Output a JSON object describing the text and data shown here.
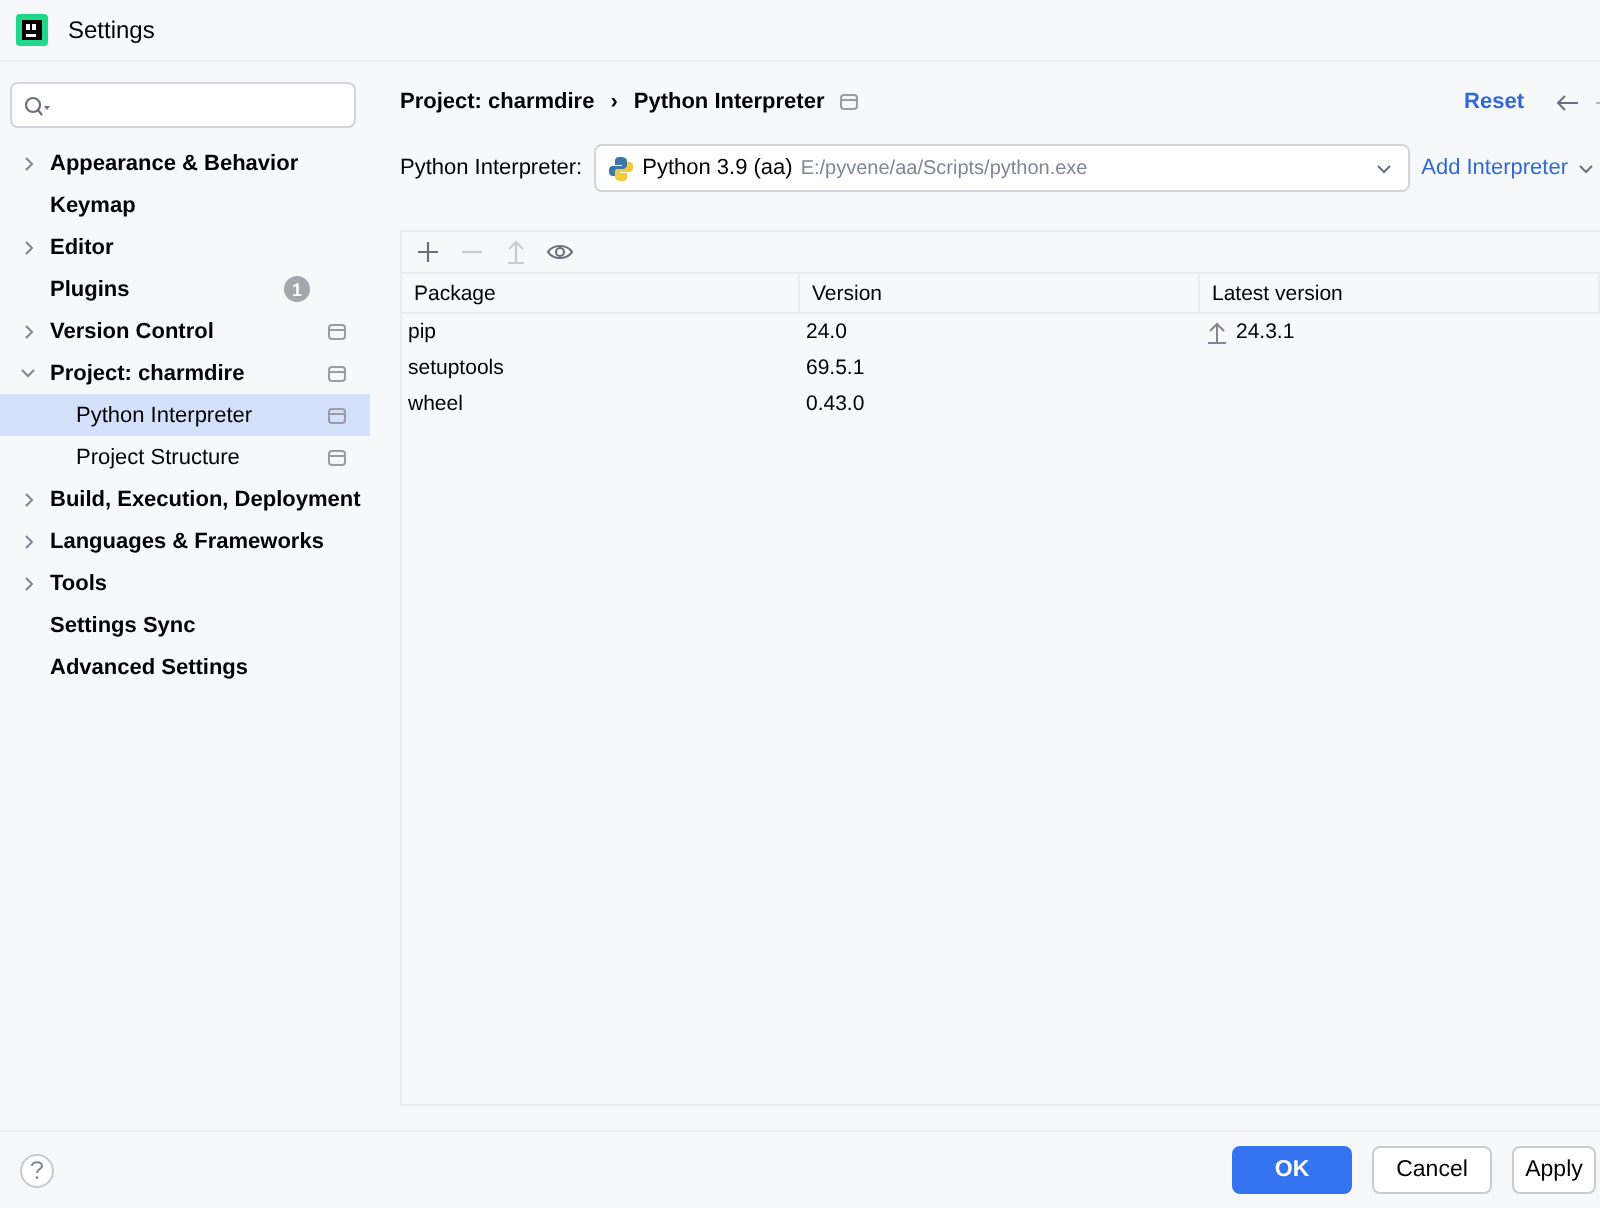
{
  "window": {
    "title": "Settings"
  },
  "sidebar": {
    "items": [
      {
        "label": "Appearance & Behavior",
        "expanded": false,
        "selected": false,
        "project_scope": false
      },
      {
        "label": "Keymap",
        "selected": false,
        "project_scope": false
      },
      {
        "label": "Editor",
        "expanded": false,
        "selected": false,
        "project_scope": false
      },
      {
        "label": "Plugins",
        "selected": false,
        "project_scope": false,
        "badge": "1"
      },
      {
        "label": "Version Control",
        "expanded": false,
        "selected": false,
        "project_scope": true
      },
      {
        "label": "Project: charmdire",
        "expanded": true,
        "selected": false,
        "project_scope": true,
        "children": [
          {
            "label": "Python Interpreter",
            "selected": true,
            "project_scope": true
          },
          {
            "label": "Project Structure",
            "selected": false,
            "project_scope": true
          }
        ]
      },
      {
        "label": "Build, Execution, Deployment",
        "expanded": false,
        "selected": false,
        "project_scope": false
      },
      {
        "label": "Languages & Frameworks",
        "expanded": false,
        "selected": false,
        "project_scope": false
      },
      {
        "label": "Tools",
        "expanded": false,
        "selected": false,
        "project_scope": false
      },
      {
        "label": "Settings Sync",
        "selected": false,
        "project_scope": false
      },
      {
        "label": "Advanced Settings",
        "selected": false,
        "project_scope": false
      }
    ]
  },
  "header": {
    "breadcrumb": [
      "Project: charmdire",
      "Python Interpreter"
    ],
    "separator": "›",
    "reset": "Reset"
  },
  "interpreter": {
    "label": "Python Interpreter:",
    "name": "Python 3.9 (aa)",
    "path": "E:/pyvene/aa/Scripts/python.exe",
    "add": "Add Interpreter"
  },
  "toolbar": [
    {
      "kind": "add",
      "disabled": false
    },
    {
      "kind": "remove",
      "disabled": true
    },
    {
      "kind": "upgrade",
      "disabled": true
    },
    {
      "kind": "show",
      "disabled": false
    }
  ],
  "table": {
    "columns": [
      "Package",
      "Version",
      "Latest version"
    ],
    "rows": [
      {
        "package": "pip",
        "version": "24.0",
        "latest": "24.3.1",
        "upgradable": true
      },
      {
        "package": "setuptools",
        "version": "69.5.1",
        "upgradable": false
      },
      {
        "package": "wheel",
        "version": "0.43.0",
        "upgradable": false
      }
    ]
  },
  "footer": {
    "buttons": [
      {
        "label": "OK",
        "primary": true
      },
      {
        "label": "Cancel",
        "primary": false
      },
      {
        "label": "Apply",
        "primary": false
      }
    ]
  }
}
